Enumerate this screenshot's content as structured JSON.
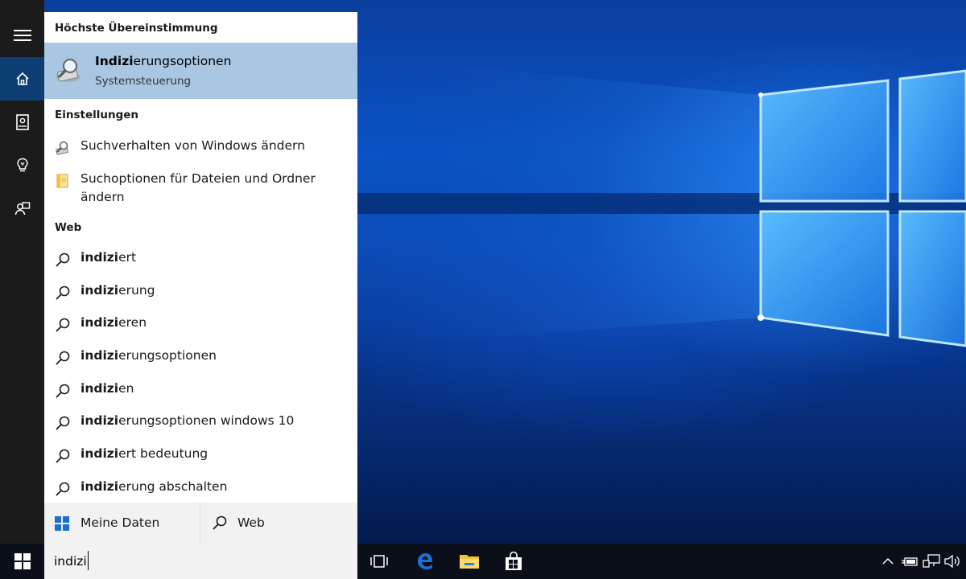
{
  "search": {
    "query": "indizi"
  },
  "best_match": {
    "header": "Höchste Übereinstimmung",
    "title_bold": "Indizi",
    "title_rest": "erungsoptionen",
    "subtitle": "Systemsteuerung",
    "icon": "indexing-magnifier-icon"
  },
  "settings": {
    "header": "Einstellungen",
    "items": [
      {
        "label": "Suchverhalten von Windows ändern",
        "icon": "search-settings-icon"
      },
      {
        "label": "Suchoptionen für Dateien und Ordner ändern",
        "icon": "folder-options-icon"
      }
    ]
  },
  "web": {
    "header": "Web",
    "items": [
      {
        "bold": "indizi",
        "rest": "ert"
      },
      {
        "bold": "indizi",
        "rest": "erung"
      },
      {
        "bold": "indizi",
        "rest": "eren"
      },
      {
        "bold": "indizi",
        "rest": "erungsoptionen"
      },
      {
        "bold": "indizi",
        "rest": "en"
      },
      {
        "bold": "indizi",
        "rest": "erungsoptionen windows 10"
      },
      {
        "bold": "indizi",
        "rest": "ert bedeutung"
      },
      {
        "bold": "indizi",
        "rest": "erung abschalten"
      }
    ]
  },
  "scopes": {
    "my_stuff": "Meine Daten",
    "web": "Web"
  },
  "rail": {
    "items": [
      "hamburger-menu-icon",
      "home-icon",
      "notebook-icon",
      "lightbulb-icon",
      "feedback-icon"
    ]
  },
  "taskbar": {
    "apps": [
      "task-view-icon",
      "edge-icon",
      "file-explorer-icon",
      "store-icon"
    ],
    "tray": [
      "chevron-up-icon",
      "battery-icon",
      "network-icon",
      "volume-icon"
    ]
  },
  "colors": {
    "accent": "#0d3e73",
    "selection": "#a9c7e2",
    "edge_blue": "#1e6fd9",
    "explorer_yellow": "#f3c33b"
  }
}
